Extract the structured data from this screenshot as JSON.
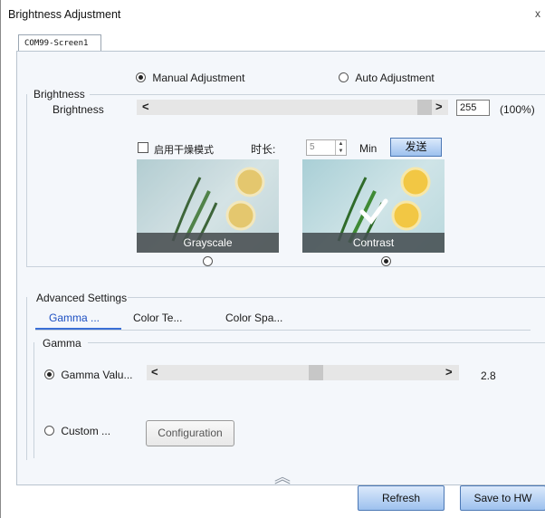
{
  "window": {
    "title": "Brightness Adjustment",
    "close_glyph": "x"
  },
  "tab": {
    "label": "COM99-Screen1"
  },
  "mode": {
    "manual_label": "Manual Adjustment",
    "auto_label": "Auto Adjustment",
    "selected": "manual"
  },
  "brightness": {
    "group_label": "Brightness",
    "row_label": "Brightness",
    "left_arrow": "<",
    "right_arrow": ">",
    "value": "255",
    "percent": "(100%)",
    "slider_fraction": 1.0
  },
  "schedule": {
    "checkbox_label": "启用干燥模式",
    "duration_label": "时长:",
    "duration_value": "5",
    "unit": "Min",
    "send_label": "发送"
  },
  "previews": [
    {
      "label": "Grayscale",
      "selected": false
    },
    {
      "label": "Contrast",
      "selected": true
    }
  ],
  "advanced": {
    "group_label": "Advanced Settings",
    "tabs": [
      "Gamma ...",
      "Color Te...",
      "Color Spa..."
    ],
    "active_tab": 0,
    "gamma_group_label": "Gamma",
    "gamma_value_label": "Gamma Valu...",
    "gamma_value": "2.8",
    "gamma_slider_fraction": 0.55,
    "left_arrow": "<",
    "right_arrow": ">",
    "custom_label": "Custom ...",
    "configuration_label": "Configuration"
  },
  "footer": {
    "collapse_glyph": "︽",
    "refresh_label": "Refresh",
    "save_label": "Save to HW"
  },
  "colors": {
    "accent": "#3b6fd6",
    "panel_bg": "#f4f7fb",
    "button_blue": "#9dc1ee"
  }
}
